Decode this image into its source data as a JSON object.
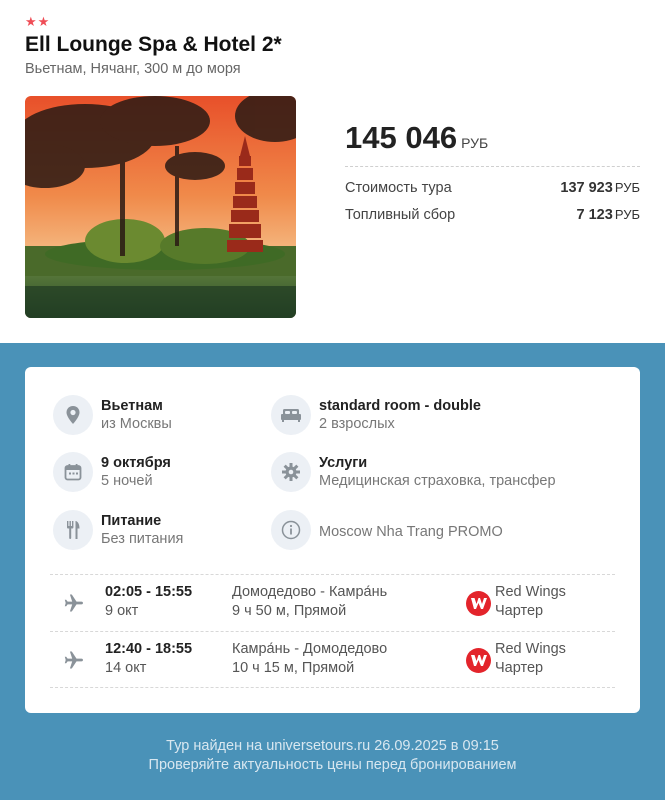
{
  "hotel": {
    "stars": "★★",
    "name": "Ell Lounge Spa & Hotel 2*",
    "location": "Вьетнам, Нячанг, 300 м до моря"
  },
  "price": {
    "total": "145 046",
    "currency": "РУБ",
    "rows": [
      {
        "label": "Стоимость тура",
        "value": "137 923",
        "currency": "РУБ"
      },
      {
        "label": "Топливный сбор",
        "value": "7 123",
        "currency": "РУБ"
      }
    ]
  },
  "details": {
    "destination": {
      "title": "Вьетнам",
      "subtitle": "из Москвы",
      "icon": "location-pin-icon"
    },
    "room": {
      "title": "standard room - double",
      "subtitle": "2 взрослых",
      "icon": "bed-icon"
    },
    "dates": {
      "title": "9 октября",
      "subtitle": "5 ночей",
      "icon": "calendar-icon"
    },
    "services": {
      "title": "Услуги",
      "subtitle": "Медицинская страховка, трансфер",
      "icon": "gear-icon"
    },
    "meals": {
      "title": "Питание",
      "subtitle": "Без питания",
      "icon": "fork-knife-icon"
    },
    "promo": {
      "text": "Moscow Nha Trang PROMO",
      "icon": "info-icon"
    }
  },
  "flights": [
    {
      "time": "02:05 - 15:55",
      "date": "9 окт",
      "route": "Домодедово - Камра́нь",
      "duration": "9 ч 50 м, Прямой",
      "airline": "Red Wings",
      "type": "Чартер"
    },
    {
      "time": "12:40 - 18:55",
      "date": "14 окт",
      "route": "Камра́нь - Домодедово",
      "duration": "10 ч 15 м, Прямой",
      "airline": "Red Wings",
      "type": "Чартер"
    }
  ],
  "footer": {
    "line1": "Тур найден на universetours.ru 26.09.2025 в 09:15",
    "line2": "Проверяйте актуальность цены перед бронированием"
  },
  "colors": {
    "accent": "#4a92b8",
    "stars": "#ef4d56",
    "airline": "#e3242b"
  }
}
